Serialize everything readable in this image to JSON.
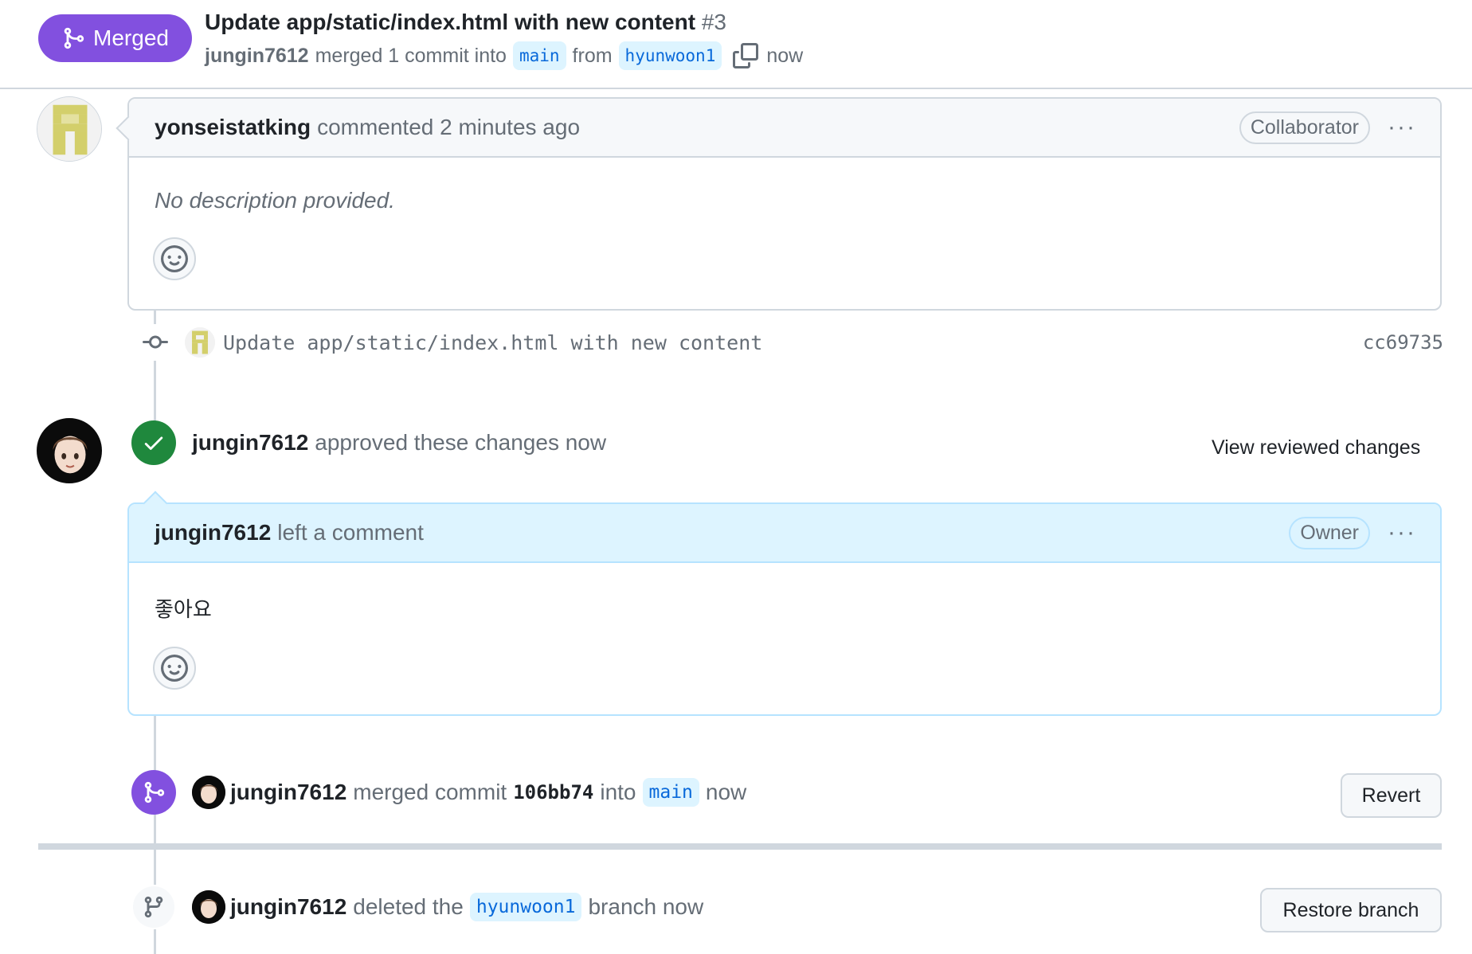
{
  "header": {
    "status_label": "Merged",
    "title": "Update app/static/index.html with new content",
    "number": "#3",
    "meta": {
      "author": "jungin7612",
      "action": "merged 1 commit into",
      "base_branch": "main",
      "from_word": "from",
      "head_branch": "hyunwoon1",
      "time": "now"
    }
  },
  "first_comment": {
    "author": "yonseistatking",
    "action": "commented 2 minutes ago",
    "role": "Collaborator",
    "more": "···",
    "body": "No description provided."
  },
  "commit": {
    "message": "Update app/static/index.html with new content",
    "sha": "cc69735"
  },
  "review": {
    "author": "jungin7612",
    "action": "approved these changes now",
    "view_link": "View reviewed changes"
  },
  "review_comment": {
    "author": "jungin7612",
    "action": "left a comment",
    "role": "Owner",
    "more": "···",
    "body": "좋아요"
  },
  "merge_event": {
    "author": "jungin7612",
    "action": "merged commit",
    "sha": "106bb74",
    "into_word": "into",
    "branch": "main",
    "time": "now",
    "button": "Revert"
  },
  "delete_event": {
    "author": "jungin7612",
    "action": "deleted the",
    "branch": "hyunwoon1",
    "suffix": "branch now",
    "button": "Restore branch"
  },
  "colors": {
    "merged_purple": "#8250df",
    "approved_green": "#1f883d",
    "branch_bg": "#ddf4ff",
    "owner_header_bg": "#ddf4ff"
  }
}
